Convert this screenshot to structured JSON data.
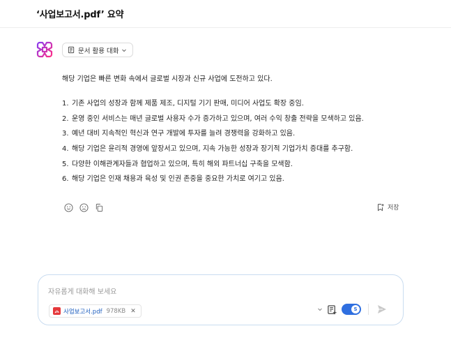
{
  "header": {
    "title": "‘사업보고서.pdf’ 요약"
  },
  "mode_chip": {
    "icon": "document-icon",
    "label": "문서 활용 대화"
  },
  "answer": {
    "intro": "해당 기업은 빠른 변화 속에서 글로벌 시장과 신규 사업에 도전하고 있다.",
    "items": [
      {
        "num": "1.",
        "text": "기존 사업의 성장과 함께 제품 제조, 디지털 기기 판매, 미디어 사업도 확장 중임."
      },
      {
        "num": "2.",
        "text": "운영 중인 서비스는 매년 글로벌 사용자 수가 증가하고 있으며, 여러 수익 창출 전략을 모색하고 있음."
      },
      {
        "num": "3.",
        "text": "예년 대비 지속적인 혁신과 연구 개발에 투자를 늘려 경쟁력을 강화하고 있음."
      },
      {
        "num": "4.",
        "text": "해당 기업은 윤리적 경영에 앞장서고 있으며, 지속 가능한 성장과 장기적 기업가치 증대를 추구함."
      },
      {
        "num": "5.",
        "text": "다양한 이해관계자들과 협업하고 있으며, 특히 해외 파트너십 구축을 모색함."
      },
      {
        "num": "6.",
        "text": "해당 기업은 인재 채용과 육성 및 인권 존중을 중요한 가치로 여기고 있음."
      }
    ]
  },
  "actions": {
    "save_label": "저장"
  },
  "composer": {
    "placeholder": "자유롭게 대화해 보세요",
    "file": {
      "name": "사업보고서.pdf",
      "size": "978KB"
    }
  },
  "colors": {
    "accent": "#2f6fe0",
    "logo": "#d12bd0",
    "pdf": "#e5383b"
  }
}
